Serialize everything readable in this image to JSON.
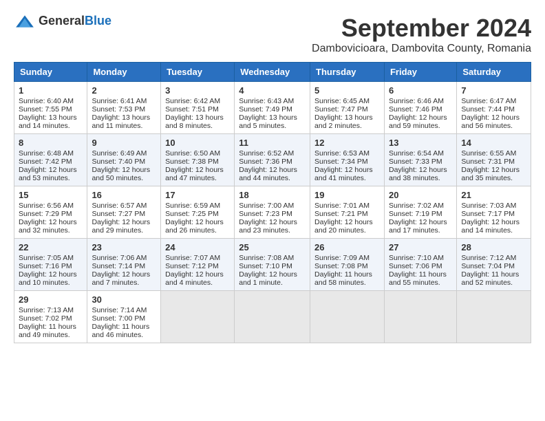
{
  "header": {
    "logo_general": "General",
    "logo_blue": "Blue",
    "month_year": "September 2024",
    "location": "Dambovicioara, Dambovita County, Romania"
  },
  "days_of_week": [
    "Sunday",
    "Monday",
    "Tuesday",
    "Wednesday",
    "Thursday",
    "Friday",
    "Saturday"
  ],
  "weeks": [
    [
      {
        "day": 1,
        "sunrise": "6:40 AM",
        "sunset": "7:55 PM",
        "daylight": "13 hours and 14 minutes."
      },
      {
        "day": 2,
        "sunrise": "6:41 AM",
        "sunset": "7:53 PM",
        "daylight": "13 hours and 11 minutes."
      },
      {
        "day": 3,
        "sunrise": "6:42 AM",
        "sunset": "7:51 PM",
        "daylight": "13 hours and 8 minutes."
      },
      {
        "day": 4,
        "sunrise": "6:43 AM",
        "sunset": "7:49 PM",
        "daylight": "13 hours and 5 minutes."
      },
      {
        "day": 5,
        "sunrise": "6:45 AM",
        "sunset": "7:47 PM",
        "daylight": "13 hours and 2 minutes."
      },
      {
        "day": 6,
        "sunrise": "6:46 AM",
        "sunset": "7:46 PM",
        "daylight": "12 hours and 59 minutes."
      },
      {
        "day": 7,
        "sunrise": "6:47 AM",
        "sunset": "7:44 PM",
        "daylight": "12 hours and 56 minutes."
      }
    ],
    [
      {
        "day": 8,
        "sunrise": "6:48 AM",
        "sunset": "7:42 PM",
        "daylight": "12 hours and 53 minutes."
      },
      {
        "day": 9,
        "sunrise": "6:49 AM",
        "sunset": "7:40 PM",
        "daylight": "12 hours and 50 minutes."
      },
      {
        "day": 10,
        "sunrise": "6:50 AM",
        "sunset": "7:38 PM",
        "daylight": "12 hours and 47 minutes."
      },
      {
        "day": 11,
        "sunrise": "6:52 AM",
        "sunset": "7:36 PM",
        "daylight": "12 hours and 44 minutes."
      },
      {
        "day": 12,
        "sunrise": "6:53 AM",
        "sunset": "7:34 PM",
        "daylight": "12 hours and 41 minutes."
      },
      {
        "day": 13,
        "sunrise": "6:54 AM",
        "sunset": "7:33 PM",
        "daylight": "12 hours and 38 minutes."
      },
      {
        "day": 14,
        "sunrise": "6:55 AM",
        "sunset": "7:31 PM",
        "daylight": "12 hours and 35 minutes."
      }
    ],
    [
      {
        "day": 15,
        "sunrise": "6:56 AM",
        "sunset": "7:29 PM",
        "daylight": "12 hours and 32 minutes."
      },
      {
        "day": 16,
        "sunrise": "6:57 AM",
        "sunset": "7:27 PM",
        "daylight": "12 hours and 29 minutes."
      },
      {
        "day": 17,
        "sunrise": "6:59 AM",
        "sunset": "7:25 PM",
        "daylight": "12 hours and 26 minutes."
      },
      {
        "day": 18,
        "sunrise": "7:00 AM",
        "sunset": "7:23 PM",
        "daylight": "12 hours and 23 minutes."
      },
      {
        "day": 19,
        "sunrise": "7:01 AM",
        "sunset": "7:21 PM",
        "daylight": "12 hours and 20 minutes."
      },
      {
        "day": 20,
        "sunrise": "7:02 AM",
        "sunset": "7:19 PM",
        "daylight": "12 hours and 17 minutes."
      },
      {
        "day": 21,
        "sunrise": "7:03 AM",
        "sunset": "7:17 PM",
        "daylight": "12 hours and 14 minutes."
      }
    ],
    [
      {
        "day": 22,
        "sunrise": "7:05 AM",
        "sunset": "7:16 PM",
        "daylight": "12 hours and 10 minutes."
      },
      {
        "day": 23,
        "sunrise": "7:06 AM",
        "sunset": "7:14 PM",
        "daylight": "12 hours and 7 minutes."
      },
      {
        "day": 24,
        "sunrise": "7:07 AM",
        "sunset": "7:12 PM",
        "daylight": "12 hours and 4 minutes."
      },
      {
        "day": 25,
        "sunrise": "7:08 AM",
        "sunset": "7:10 PM",
        "daylight": "12 hours and 1 minute."
      },
      {
        "day": 26,
        "sunrise": "7:09 AM",
        "sunset": "7:08 PM",
        "daylight": "11 hours and 58 minutes."
      },
      {
        "day": 27,
        "sunrise": "7:10 AM",
        "sunset": "7:06 PM",
        "daylight": "11 hours and 55 minutes."
      },
      {
        "day": 28,
        "sunrise": "7:12 AM",
        "sunset": "7:04 PM",
        "daylight": "11 hours and 52 minutes."
      }
    ],
    [
      {
        "day": 29,
        "sunrise": "7:13 AM",
        "sunset": "7:02 PM",
        "daylight": "11 hours and 49 minutes."
      },
      {
        "day": 30,
        "sunrise": "7:14 AM",
        "sunset": "7:00 PM",
        "daylight": "11 hours and 46 minutes."
      },
      null,
      null,
      null,
      null,
      null
    ]
  ],
  "labels": {
    "sunrise": "Sunrise:",
    "sunset": "Sunset:",
    "daylight": "Daylight:"
  }
}
